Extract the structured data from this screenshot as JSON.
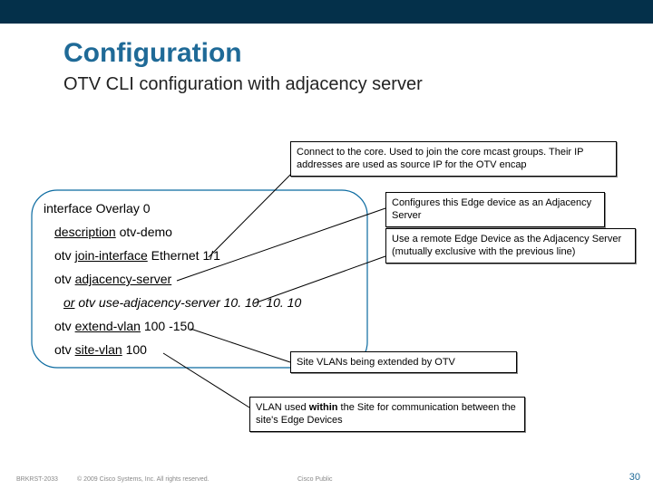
{
  "header": {
    "title": "Configuration",
    "subtitle": "OTV CLI configuration with adjacency server"
  },
  "callouts": {
    "c1": "Connect to the core. Used to join the core mcast groups. Their IP addresses are used as source IP for the OTV encap",
    "c2": "Configures this Edge device as an Adjacency Server",
    "c3": "Use a remote Edge Device as the Adjacency Server (mutually exclusive with the previous line)",
    "c4": "Site VLANs being extended by OTV",
    "c5_a": "VLAN used ",
    "c5_b": "within",
    "c5_c": " the Site for communication between the site's Edge Devices"
  },
  "cli": {
    "l1": "interface Overlay 0",
    "l2_a": "description",
    "l2_b": " otv-demo",
    "l3_a": "otv ",
    "l3_b": "join-interface",
    "l3_c": " Ethernet 1/1",
    "l4_a": "otv ",
    "l4_b": "adjacency-server",
    "l5_a": "or",
    "l5_b": "  otv use-adjacency-server 10. 10. 10. 10",
    "l6_a": "otv ",
    "l6_b": "extend-vlan",
    "l6_c": " 100 -150",
    "l7_a": "otv ",
    "l7_b": "site-vlan",
    "l7_c": " 100"
  },
  "footer": {
    "left": "BRKRST-2033",
    "mid": "© 2009 Cisco Systems, Inc. All rights reserved.",
    "center": "Cisco Public",
    "right": "30"
  }
}
